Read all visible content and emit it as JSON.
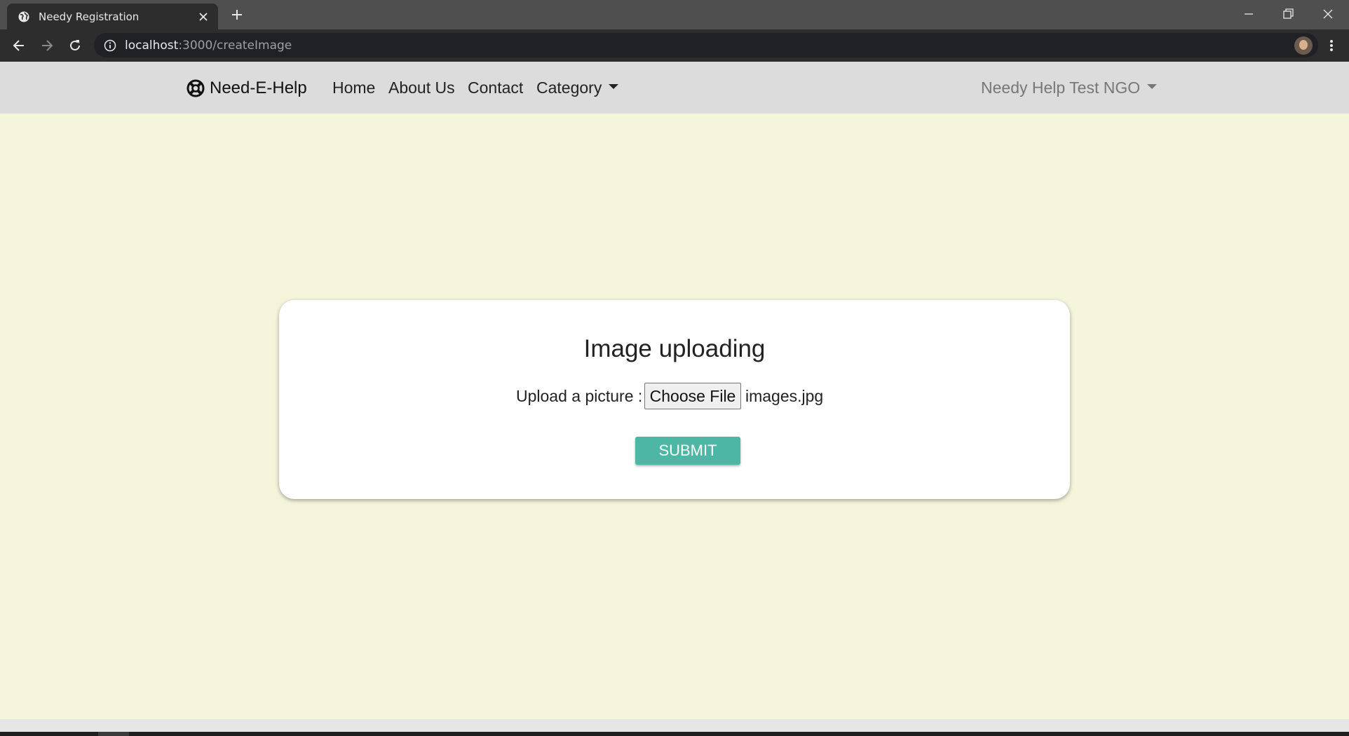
{
  "browser": {
    "tab_title": "Needy Registration",
    "url_host": "localhost",
    "url_rest": ":3000/createImage"
  },
  "navbar": {
    "brand": "Need-E-Help",
    "links": [
      "Home",
      "About Us",
      "Contact",
      "Category"
    ],
    "user_menu": "Needy Help Test NGO"
  },
  "card": {
    "title": "Image uploading",
    "upload_label": "Upload a picture :",
    "choose_file": "Choose File",
    "file_name": "images.jpg",
    "submit": "SUBMIT"
  },
  "colors": {
    "page_bg": "#f5f5dc",
    "navbar_bg": "#dcdcdc",
    "submit_bg": "#4db6a4"
  },
  "icons": [
    "globe-icon",
    "close-icon",
    "plus-icon",
    "minimize-icon",
    "restore-icon",
    "window-close-icon",
    "back-icon",
    "forward-icon",
    "reload-icon",
    "info-icon",
    "star-icon",
    "kebab-menu-icon",
    "life-ring-icon",
    "caret-down-icon"
  ]
}
